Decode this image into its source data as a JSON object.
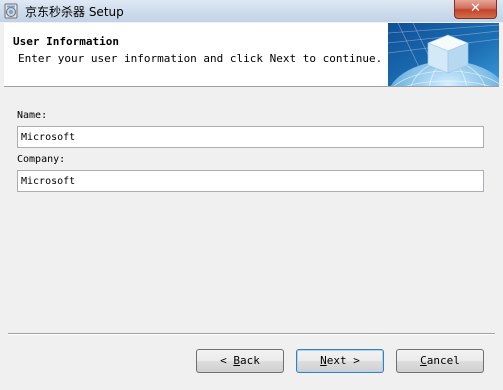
{
  "window": {
    "title": "京东秒杀器 Setup",
    "icon": "setup-disc-icon",
    "close_glyph": "✕"
  },
  "header": {
    "title": "User Information",
    "subtitle": "Enter your user information and click Next to continue."
  },
  "form": {
    "name_label": "Name:",
    "name_value": "Microsoft",
    "company_label": "Company:",
    "company_value": "Microsoft"
  },
  "buttons": {
    "back": {
      "glyph": "< ",
      "mnemonic": "B",
      "rest": "ack"
    },
    "next": {
      "mnemonic": "N",
      "rest": "ext",
      "glyph": " >"
    },
    "cancel": {
      "mnemonic": "C",
      "rest": "ancel"
    }
  },
  "colors": {
    "close_button": "#c4442b",
    "header_art_sky": "#1d6fb5",
    "header_art_globe": "#6fb3e0",
    "default_button_border": "#3c7fb1"
  }
}
